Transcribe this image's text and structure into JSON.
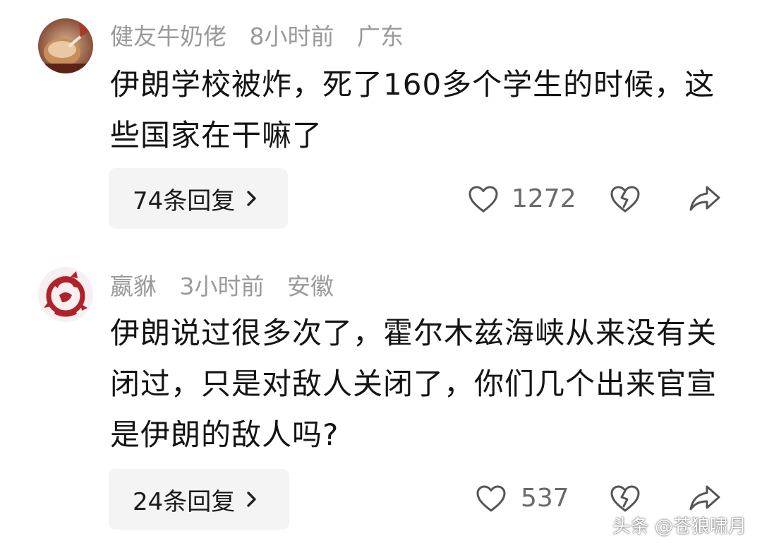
{
  "comments": [
    {
      "username": "健友牛奶佬",
      "time": "8小时前",
      "location": "广东",
      "text": "伊朗学校被炸，死了160多个学生的时候，这些国家在干嘛了",
      "replies_label": "74条回复",
      "likes": "1272",
      "avatar_icon": "milk-tea-avatar"
    },
    {
      "username": "嬴貅",
      "time": "3小时前",
      "location": "安徽",
      "text": "伊朗说过很多次了，霍尔木兹海峡从来没有关闭过，只是对敌人关闭了，你们几个出来官宣是伊朗的敌人吗?",
      "replies_label": "24条回复",
      "likes": "537",
      "avatar_icon": "red-dragon-avatar"
    }
  ],
  "watermark": "头条 @苍狼啸月",
  "colors": {
    "meta_gray": "#9a9a9a",
    "button_bg": "#f4f4f4",
    "icon_gray": "#555555",
    "dragon_red": "#b0212a"
  }
}
